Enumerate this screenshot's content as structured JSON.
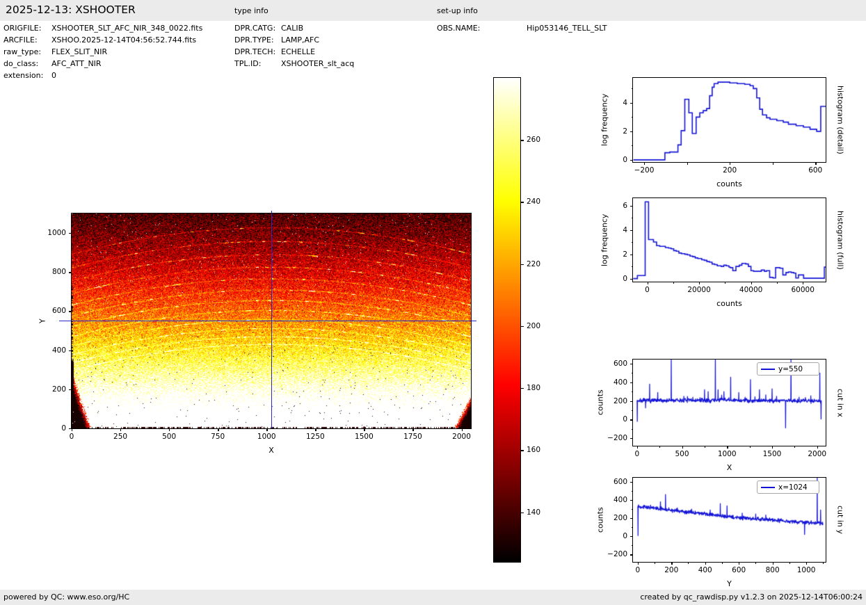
{
  "header": {
    "title": "2025-12-13: XSHOOTER",
    "type_info_label": "type info",
    "setup_info_label": "set-up info"
  },
  "file_info": {
    "rows": [
      {
        "label": "ORIGFILE:",
        "value": "XSHOOTER_SLT_AFC_NIR_348_0022.fits"
      },
      {
        "label": "ARCFILE:",
        "value": "XSHOO.2025-12-14T04:56:52.744.fits"
      },
      {
        "label": "raw_type:",
        "value": "FLEX_SLIT_NIR"
      },
      {
        "label": "do_class:",
        "value": "AFC_ATT_NIR"
      },
      {
        "label": "extension:",
        "value": "0"
      }
    ]
  },
  "type_info": {
    "rows": [
      {
        "label": "DPR.CATG:",
        "value": "CALIB"
      },
      {
        "label": "DPR.TYPE:",
        "value": "LAMP,AFC"
      },
      {
        "label": "DPR.TECH:",
        "value": "ECHELLE"
      },
      {
        "label": "TPL.ID:",
        "value": "XSHOOTER_slt_acq"
      }
    ]
  },
  "setup_info": {
    "rows": [
      {
        "label": "OBS.NAME:",
        "value": "Hip053146_TELL_SLT"
      }
    ]
  },
  "footer": {
    "left": "powered by QC: www.eso.org/HC",
    "right": "created by qc_rawdisp.py v1.2.3 on 2025-12-14T06:00:24"
  },
  "colors": {
    "bar_bg": "#ebebeb",
    "line": "#1414d6",
    "crosshair": "#2a2ac8",
    "axis": "#000000"
  },
  "chart_data": [
    {
      "id": "detector_image",
      "type": "heatmap",
      "xlabel": "X",
      "ylabel": "Y",
      "xlim": [
        0,
        2048
      ],
      "ylim": [
        0,
        1100
      ],
      "xticks": [
        0,
        250,
        500,
        750,
        1000,
        1250,
        1500,
        1750,
        2000
      ],
      "yticks": [
        0,
        200,
        400,
        600,
        800,
        1000
      ],
      "colormap": "hot",
      "vmin": 124,
      "vmax": 280,
      "crosshair": {
        "x": 1024,
        "y": 550
      },
      "counts_profile": [
        [
          0,
          330
        ],
        [
          550,
          213
        ],
        [
          1100,
          140
        ]
      ],
      "noise_sigma": 15,
      "order_arcs": {
        "apex_y": [
          1028,
          958,
          890,
          826,
          766,
          709,
          655,
          604,
          556,
          511,
          469,
          430
        ],
        "sag": 135
      },
      "dark_corners": [
        "bottom-left",
        "bottom-right"
      ]
    },
    {
      "id": "colorbar",
      "type": "colorbar",
      "colormap": "hot",
      "vmin": 124,
      "vmax": 280,
      "ticks": [
        140,
        160,
        180,
        200,
        220,
        240,
        260
      ]
    },
    {
      "id": "histogram_detail",
      "type": "step",
      "right_label": "histogram (detail)",
      "xlabel": "counts",
      "ylabel": "log frequency",
      "xlim": [
        -252,
        648
      ],
      "ylim": [
        -0.15,
        5.75
      ],
      "xticks": [
        -200,
        0,
        200,
        400,
        600
      ],
      "xtick_labels": [
        "-200",
        "",
        "200",
        "",
        "600"
      ],
      "yticks": [
        0,
        2,
        4
      ],
      "yticks_minor": [
        1,
        3,
        5
      ],
      "steps": [
        [
          -250,
          0
        ],
        [
          -103,
          0.5
        ],
        [
          -80,
          0.55
        ],
        [
          -42,
          1.05
        ],
        [
          -27,
          2.05
        ],
        [
          -10,
          4.25
        ],
        [
          9,
          3.3
        ],
        [
          25,
          1.85
        ],
        [
          43,
          3.0
        ],
        [
          60,
          3.3
        ],
        [
          76,
          3.45
        ],
        [
          92,
          3.6
        ],
        [
          106,
          4.5
        ],
        [
          118,
          5.1
        ],
        [
          127,
          5.35
        ],
        [
          145,
          5.45
        ],
        [
          200,
          5.4
        ],
        [
          235,
          5.35
        ],
        [
          270,
          5.3
        ],
        [
          295,
          5.2
        ],
        [
          310,
          5.0
        ],
        [
          326,
          4.35
        ],
        [
          340,
          3.55
        ],
        [
          353,
          3.15
        ],
        [
          372,
          2.95
        ],
        [
          388,
          2.85
        ],
        [
          420,
          2.75
        ],
        [
          450,
          2.65
        ],
        [
          474,
          2.5
        ],
        [
          510,
          2.4
        ],
        [
          544,
          2.3
        ],
        [
          575,
          2.15
        ],
        [
          606,
          2.0
        ],
        [
          625,
          3.75
        ],
        [
          648,
          3.75
        ]
      ]
    },
    {
      "id": "histogram_full",
      "type": "step",
      "right_label": "histogram (full)",
      "xlabel": "counts",
      "ylabel": "log frequency",
      "xlim": [
        -5500,
        68800
      ],
      "ylim": [
        -0.25,
        6.6
      ],
      "xticks": [
        0,
        20000,
        40000,
        60000
      ],
      "xticks_minor": [
        10000,
        30000,
        50000
      ],
      "yticks": [
        0,
        2,
        4,
        6
      ],
      "yticks_minor": [
        1,
        3,
        5
      ],
      "steps": [
        [
          -5400,
          0
        ],
        [
          -3800,
          0.25
        ],
        [
          -800,
          6.3
        ],
        [
          500,
          3.2
        ],
        [
          2400,
          3.0
        ],
        [
          3600,
          2.7
        ],
        [
          4800,
          2.65
        ],
        [
          7000,
          2.55
        ],
        [
          8200,
          2.5
        ],
        [
          9200,
          2.45
        ],
        [
          10200,
          2.3
        ],
        [
          11200,
          2.25
        ],
        [
          12200,
          2.1
        ],
        [
          13200,
          2.05
        ],
        [
          14500,
          2.0
        ],
        [
          15500,
          1.95
        ],
        [
          16500,
          1.85
        ],
        [
          17500,
          1.8
        ],
        [
          18500,
          1.7
        ],
        [
          19500,
          1.65
        ],
        [
          21000,
          1.55
        ],
        [
          22000,
          1.5
        ],
        [
          23000,
          1.4
        ],
        [
          24000,
          1.35
        ],
        [
          25000,
          1.2
        ],
        [
          26000,
          1.15
        ],
        [
          27000,
          1.05
        ],
        [
          28500,
          1.0
        ],
        [
          29500,
          1.1
        ],
        [
          30500,
          1.05
        ],
        [
          31500,
          0.95
        ],
        [
          32000,
          0.9
        ],
        [
          33000,
          0.65
        ],
        [
          34200,
          1.0
        ],
        [
          35500,
          1.1
        ],
        [
          36500,
          1.25
        ],
        [
          38000,
          1.2
        ],
        [
          39000,
          1.0
        ],
        [
          40000,
          0.65
        ],
        [
          41000,
          0.6
        ],
        [
          44000,
          0.7
        ],
        [
          45200,
          0.6
        ],
        [
          46000,
          0.65
        ],
        [
          47200,
          0.1
        ],
        [
          48500,
          0.05
        ],
        [
          49500,
          0.9
        ],
        [
          51200,
          0.85
        ],
        [
          52300,
          0.3
        ],
        [
          53500,
          0.5
        ],
        [
          54500,
          0.55
        ],
        [
          55500,
          0.5
        ],
        [
          56500,
          0.45
        ],
        [
          57300,
          0.05
        ],
        [
          58300,
          0.3
        ],
        [
          60300,
          0.03
        ],
        [
          67900,
          0.03
        ],
        [
          68300,
          0.95
        ],
        [
          68700,
          0.95
        ]
      ]
    },
    {
      "id": "cut_in_x",
      "type": "noisy_line",
      "legend": "y=550",
      "right_label": "cut in x",
      "xlabel": "X",
      "ylabel": "counts",
      "xlim": [
        -45,
        2095
      ],
      "ylim": [
        -282,
        645
      ],
      "xticks": [
        0,
        500,
        1000,
        1500,
        2000
      ],
      "xticks_minor": [
        250,
        750,
        1250,
        1750
      ],
      "yticks": [
        -200,
        0,
        200,
        400,
        600
      ],
      "yticks_minor": [
        -100,
        100,
        300,
        500
      ],
      "noise_sigma": 11,
      "seed": 7,
      "trend": [
        [
          0,
          203
        ],
        [
          850,
          206
        ],
        [
          950,
          216
        ],
        [
          1050,
          206
        ],
        [
          2048,
          202
        ]
      ],
      "spikes": [
        [
          3,
          -20
        ],
        [
          95,
          125
        ],
        [
          140,
          380
        ],
        [
          230,
          290
        ],
        [
          380,
          645
        ],
        [
          520,
          250
        ],
        [
          560,
          248
        ],
        [
          620,
          240
        ],
        [
          700,
          235
        ],
        [
          750,
          320
        ],
        [
          790,
          300
        ],
        [
          870,
          650
        ],
        [
          900,
          320
        ],
        [
          940,
          262
        ],
        [
          965,
          300
        ],
        [
          1040,
          455
        ],
        [
          1130,
          290
        ],
        [
          1200,
          240
        ],
        [
          1260,
          430
        ],
        [
          1310,
          245
        ],
        [
          1360,
          320
        ],
        [
          1430,
          265
        ],
        [
          1500,
          330
        ],
        [
          1550,
          250
        ],
        [
          1650,
          -90
        ],
        [
          1710,
          650
        ],
        [
          1800,
          240
        ],
        [
          1870,
          237
        ],
        [
          1930,
          255
        ],
        [
          2030,
          500
        ],
        [
          2044,
          5
        ]
      ]
    },
    {
      "id": "cut_in_y",
      "type": "noisy_line",
      "legend": "x=1024",
      "right_label": "cut in y",
      "xlabel": "Y",
      "ylabel": "counts",
      "xlim": [
        -28,
        1115
      ],
      "ylim": [
        -282,
        645
      ],
      "xticks": [
        0,
        200,
        400,
        600,
        800,
        1000
      ],
      "xticks_minor": [
        100,
        300,
        500,
        700,
        900,
        1100
      ],
      "yticks": [
        -200,
        0,
        200,
        400,
        600
      ],
      "yticks_minor": [
        -100,
        100,
        300,
        500
      ],
      "noise_sigma": 10,
      "seed": 13,
      "trend": [
        [
          0,
          332
        ],
        [
          550,
          213
        ],
        [
          1100,
          140
        ]
      ],
      "spikes": [
        [
          2,
          8
        ],
        [
          135,
          380
        ],
        [
          165,
          460
        ],
        [
          235,
          312
        ],
        [
          320,
          300
        ],
        [
          430,
          290
        ],
        [
          490,
          360
        ],
        [
          530,
          335
        ],
        [
          620,
          255
        ],
        [
          700,
          245
        ],
        [
          760,
          235
        ],
        [
          990,
          20
        ],
        [
          1065,
          645
        ],
        [
          1085,
          290
        ]
      ]
    }
  ]
}
